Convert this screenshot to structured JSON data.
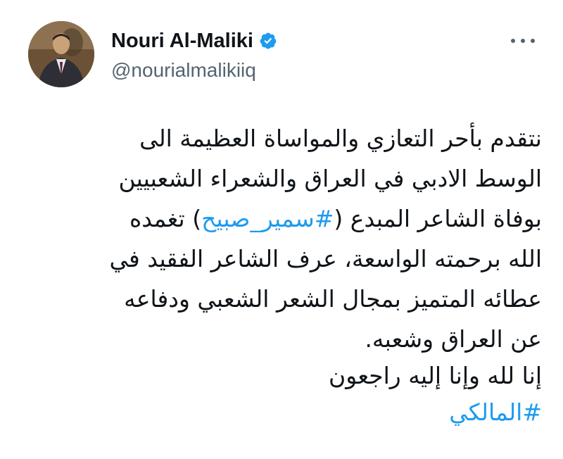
{
  "user": {
    "display_name": "Nouri Al-Maliki",
    "handle": "@nourialmalikiiq",
    "verified": true
  },
  "tweet": {
    "line1": "نتقدم بأحر التعازي والمواساة العظيمة الى",
    "line2": "الوسط الادبي في العراق والشعراء الشعبيين",
    "line3_before": "بوفاة الشاعر المبدع (",
    "line3_hashtag": "#سمير_صبيح",
    "line3_after": ") تغمده",
    "line4": "الله برحمته الواسعة، عرف الشاعر الفقيد في",
    "line5": "عطائه المتميز بمجال الشعر الشعبي ودفاعه",
    "line6": "عن العراق وشعبه.",
    "line7": "إنا لله وإنا إليه راجعون",
    "hashtag_end": "#المالكي"
  },
  "colors": {
    "text": "#0f1419",
    "secondary": "#536471",
    "link": "#1d9bf0",
    "verified": "#1d9bf0"
  },
  "icons": {
    "verified": "verified-badge-icon",
    "more": "more-dots-icon"
  }
}
